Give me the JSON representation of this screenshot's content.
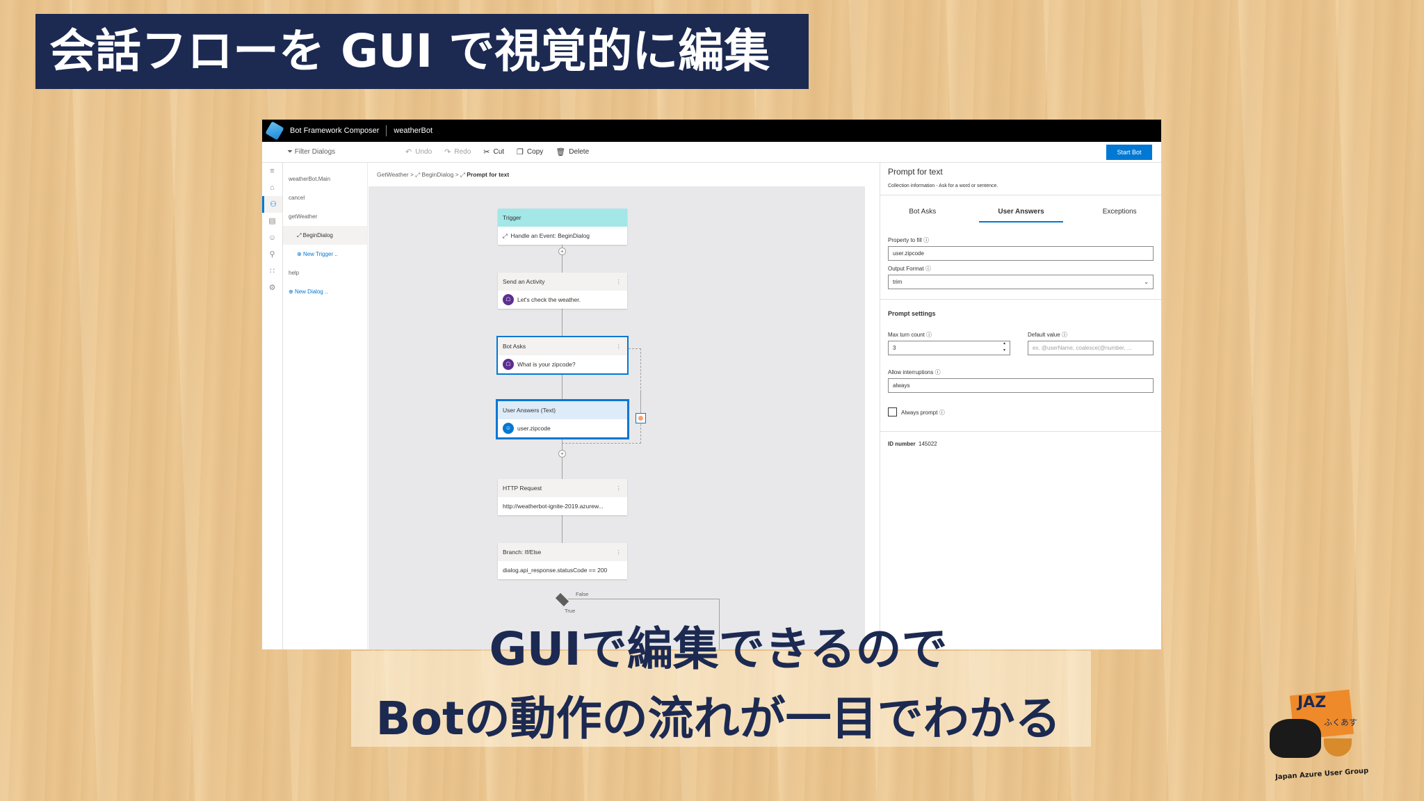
{
  "banner": {
    "title": "会話フローを GUI で視覚的に編集"
  },
  "app": {
    "title": "Bot Framework Composer",
    "bot_name": "weatherBot",
    "toolbar": {
      "filter": "Filter Dialogs",
      "undo": "Undo",
      "redo": "Redo",
      "cut": "Cut",
      "copy": "Copy",
      "delete": "Delete",
      "start_bot": "Start Bot"
    },
    "dialogs": [
      {
        "label": "weatherBot.Main"
      },
      {
        "label": "cancel"
      },
      {
        "label": "getWeather"
      },
      {
        "label": "BeginDialog"
      },
      {
        "label": "New Trigger .."
      },
      {
        "label": "help"
      },
      {
        "label": "New Dialog .."
      }
    ],
    "breadcrumb": {
      "a": "GetWeather",
      "b": "BeginDialog",
      "c": "Prompt for text"
    },
    "flow": {
      "trigger": {
        "header": "Trigger",
        "body": "Handle an Event: BeginDialog"
      },
      "send": {
        "header": "Send an Activity",
        "body": "Let's check the weather."
      },
      "ask": {
        "header": "Bot Asks",
        "body": "What is your zipcode?"
      },
      "answer": {
        "header": "User Answers (Text)",
        "body": "user.zipcode"
      },
      "http": {
        "header": "HTTP Request",
        "body": "http://weatherbot-ignite-2019.azurew..."
      },
      "branch": {
        "header": "Branch: If/Else",
        "body": "dialog.api_response.statusCode == 200"
      },
      "false_label": "False",
      "true_label": "True"
    },
    "panel": {
      "title": "Prompt for text",
      "desc": "Collection information - Ask for a word or sentence.",
      "tabs": [
        "Bot Asks",
        "User Answers",
        "Exceptions"
      ],
      "property_label": "Property to fill",
      "property_value": "user.zipcode",
      "output_label": "Output Format",
      "output_value": "trim",
      "prompt_settings": "Prompt settings",
      "max_turn_label": "Max turn count",
      "max_turn_value": "3",
      "default_label": "Default value",
      "default_placeholder": "ex. @userName, coalesce(@number, ...",
      "interrupt_label": "Allow interruptions",
      "interrupt_value": "always",
      "always_prompt": "Always prompt",
      "id_label": "ID number",
      "id_value": "145022"
    }
  },
  "caption": {
    "line1": "GUIで編集できるので",
    "line2": "Botの動作の流れが一目でわかる"
  },
  "logo": {
    "text": "JAZ",
    "sub": "ふくあす",
    "group": "Japan Azure User Group"
  }
}
